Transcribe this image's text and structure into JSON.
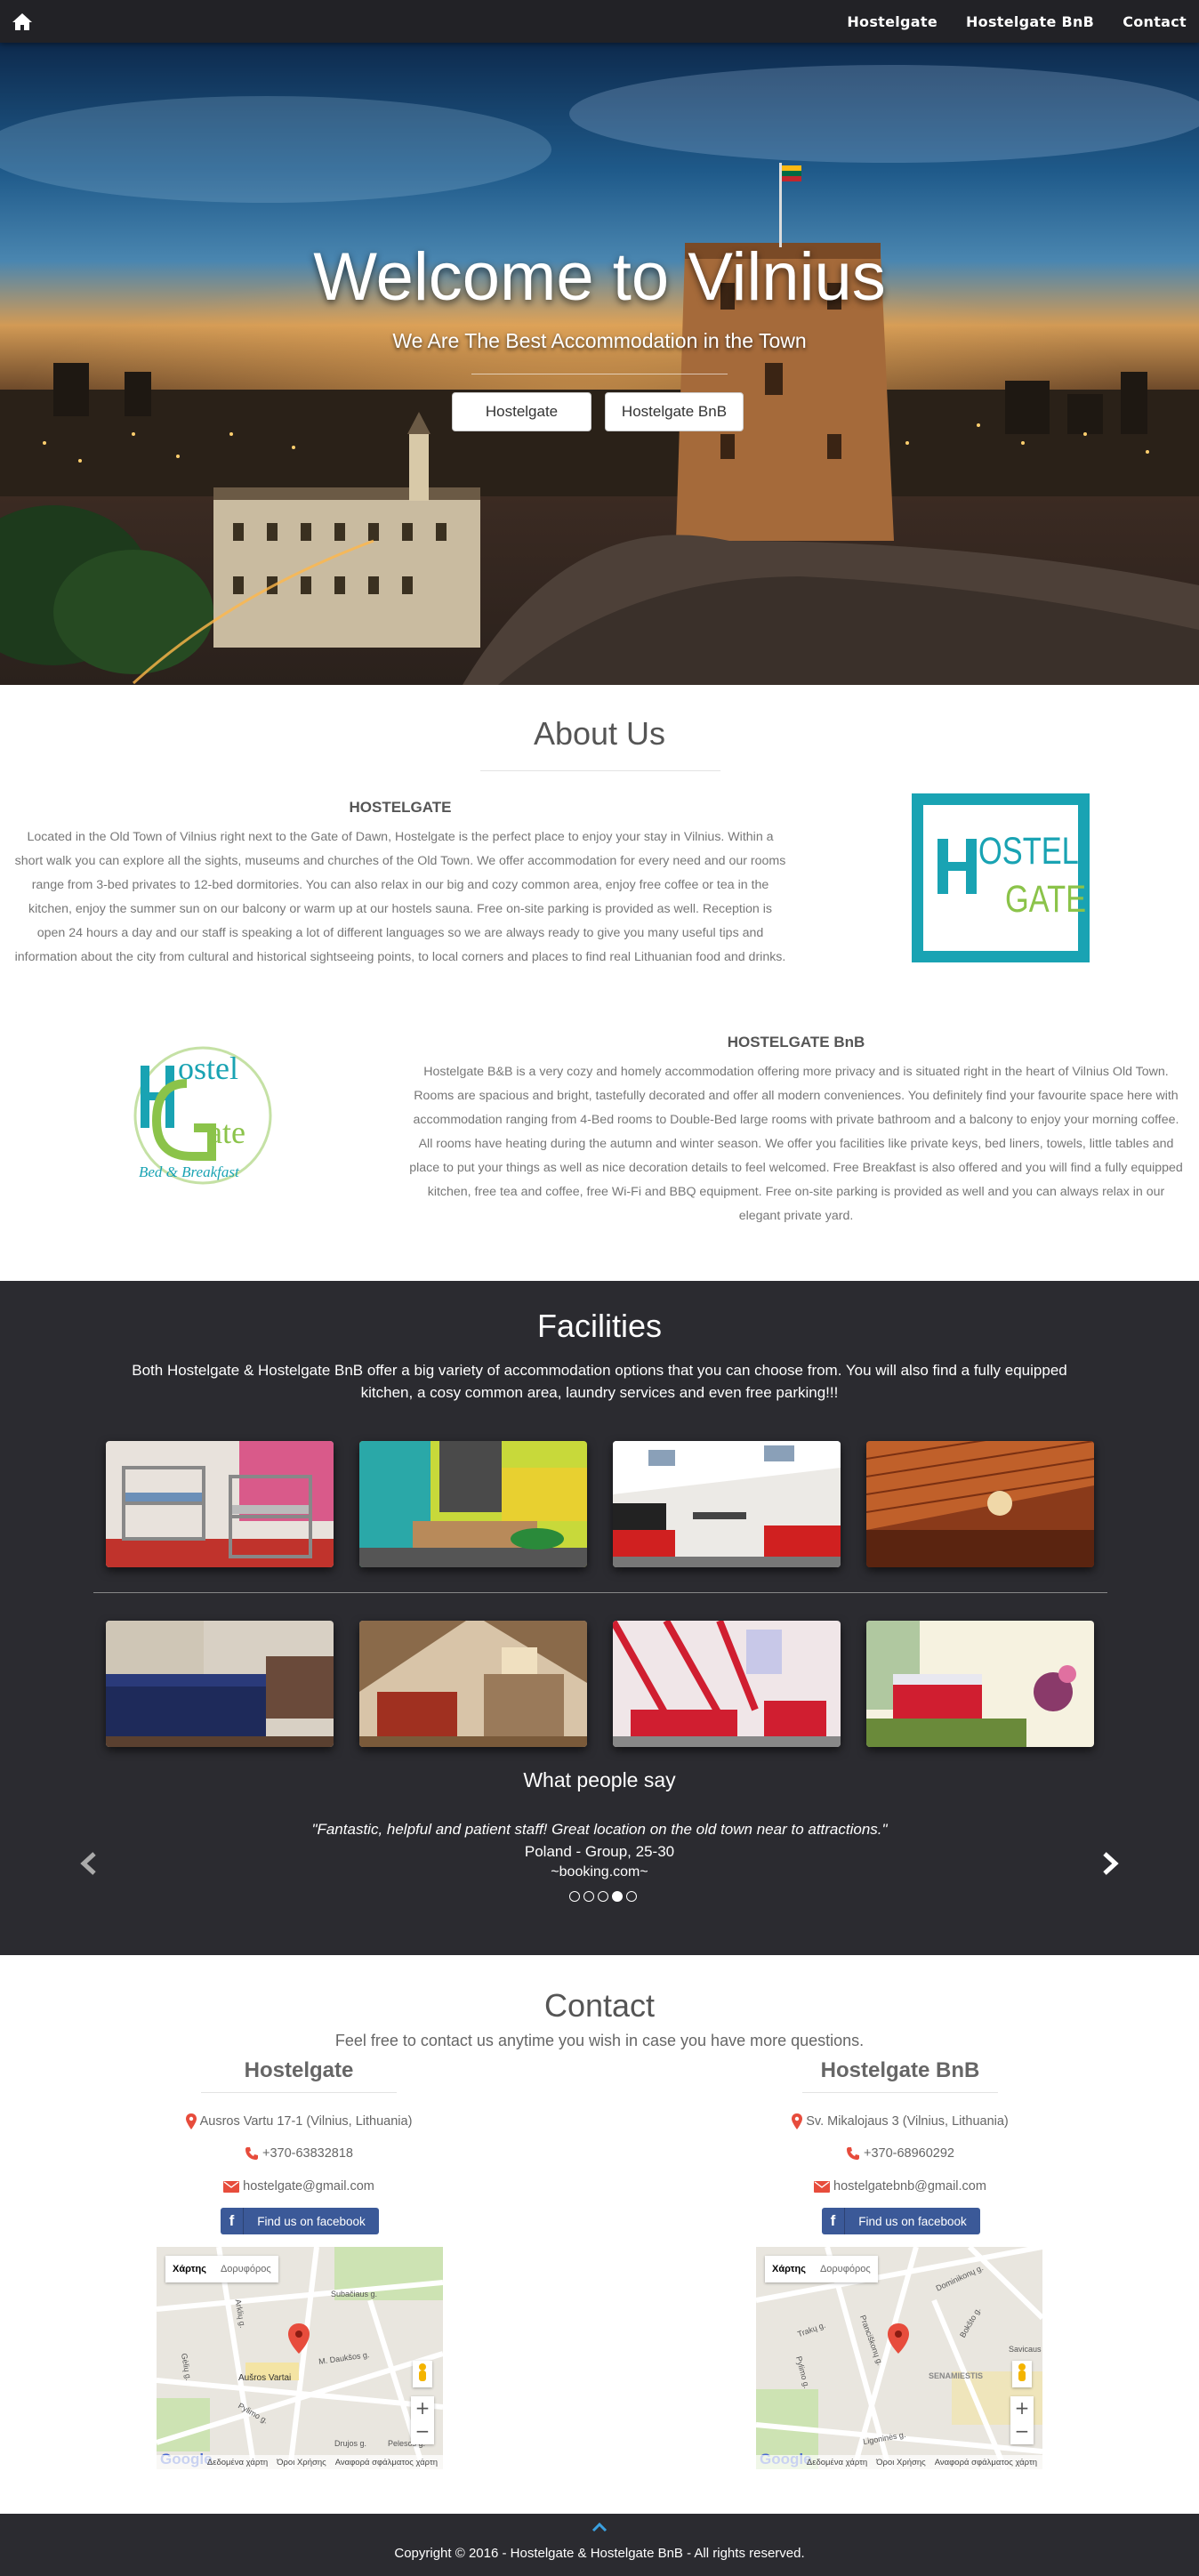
{
  "nav": {
    "links": [
      "Hostelgate",
      "Hostelgate BnB",
      "Contact"
    ]
  },
  "hero": {
    "title": "Welcome to Vilnius",
    "subtitle": "We Are The Best Accommodation in the Town",
    "buttons": [
      "Hostelgate",
      "Hostelgate BnB"
    ]
  },
  "about": {
    "title": "About Us",
    "hostelgate": {
      "heading": "HOSTELGATE",
      "text": "Located in the Old Town of Vilnius right next to the Gate of Dawn, Hostelgate is the perfect place to enjoy your stay in Vilnius. Within a short walk you can explore all the sights, museums and churches of the Old Town. We offer accommodation for every need and our rooms range from 3-bed privates to 12-bed dormitories. You can also relax in our big and cozy common area, enjoy free coffee or tea in the kitchen, enjoy the summer sun on our balcony or warm up at our hostels sauna. Free on-site parking is provided as well. Reception is open 24 hours a day and our staff is speaking a lot of different languages so we are always ready to give you many useful tips and information about the city from cultural and historical sightseeing points, to local corners and places to find real Lithuanian food and drinks.",
      "logo_line1": "OSTEL",
      "logo_line2": "GATE"
    },
    "bnb": {
      "heading": "HOSTELGATE BnB",
      "text": "Hostelgate B&B is a very cozy and homely accommodation offering more privacy and is situated right in the heart of Vilnius Old Town. Rooms are spacious and bright, tastefully decorated and offer all modern conveniences. You definitely find your favourite space here with accommodation ranging from 4-Bed rooms to Double-Bed large rooms with private bathroom and a balcony to enjoy your morning coffee. All rooms have heating during the autumn and winter season. We offer you facilities like private keys, bed liners, towels, little tables and place to put your things as well as nice decoration details to feel welcomed. Free Breakfast is also offered and you will find a fully equipped kitchen, free tea and coffee, free Wi-Fi and BBQ equipment. Free on-site parking is provided as well and you can always relax in our elegant private yard.",
      "logo_line1": "ostel",
      "logo_line2": "ate",
      "logo_line3": "Bed & Breakfast"
    }
  },
  "facilities": {
    "title": "Facilities",
    "text": "Both Hostelgate & Hostelgate BnB offer a big variety of accommodation options that you can choose from. You will also find a fully equipped kitchen, a cosy common area, laundry services and even free parking!!!"
  },
  "testimonials": {
    "title": "What people say",
    "quote": "\"Fantastic, helpful and patient staff! Great location on the old town near to attractions.\"",
    "author": "Poland - Group, 25-30",
    "source": "~booking.com~",
    "active_slide": 4,
    "slide_count": 5
  },
  "contact": {
    "title": "Contact",
    "subtitle": "Feel free to contact us anytime you wish in case you have more questions.",
    "hostelgate": {
      "name": "Hostelgate",
      "address": "Ausros Vartu 17-1 (Vilnius, Lithuania)",
      "phone": "+370-63832818",
      "email": "hostelgate@gmail.com",
      "facebook": "Find us on facebook"
    },
    "bnb": {
      "name": "Hostelgate BnB",
      "address": "Sv. Mikalojaus 3 (Vilnius, Lithuania)",
      "phone": "+370-68960292",
      "email": "hostelgatebnb@gmail.com",
      "facebook": "Find us on facebook"
    },
    "map": {
      "tab_map": "Χάρτης",
      "tab_satellite": "Δορυφόρος",
      "footer": [
        "Δεδομένα χάρτη",
        "Όροι Χρήσης",
        "Αναφορά σφάλματος χάρτη"
      ],
      "brand": "Google",
      "labels1": [
        "Subačiaus g.",
        "Aušros Vartai",
        "M. Daukšos g.",
        "Pylimo g.",
        "Arklių g.",
        "Gėlių g.",
        "Drujos g.",
        "Pelesos g."
      ],
      "labels2": [
        "Dominikonų g.",
        "Trakų g.",
        "Pranciškonų g.",
        "Pylimo g.",
        "SENAMIESTIS",
        "Savicaus",
        "Ligoninės g.",
        "Bokšto g."
      ]
    }
  },
  "footer": {
    "copyright": "Copyright © 2016 - Hostelgate & Hostelgate BnB - All rights reserved."
  },
  "colors": {
    "nav_bg": "#222226",
    "dark_section": "#2b2b30",
    "accent_teal": "#19a3b3",
    "accent_green": "#8bc34a",
    "facebook": "#3b5998",
    "pin_red": "#e74c3c"
  }
}
